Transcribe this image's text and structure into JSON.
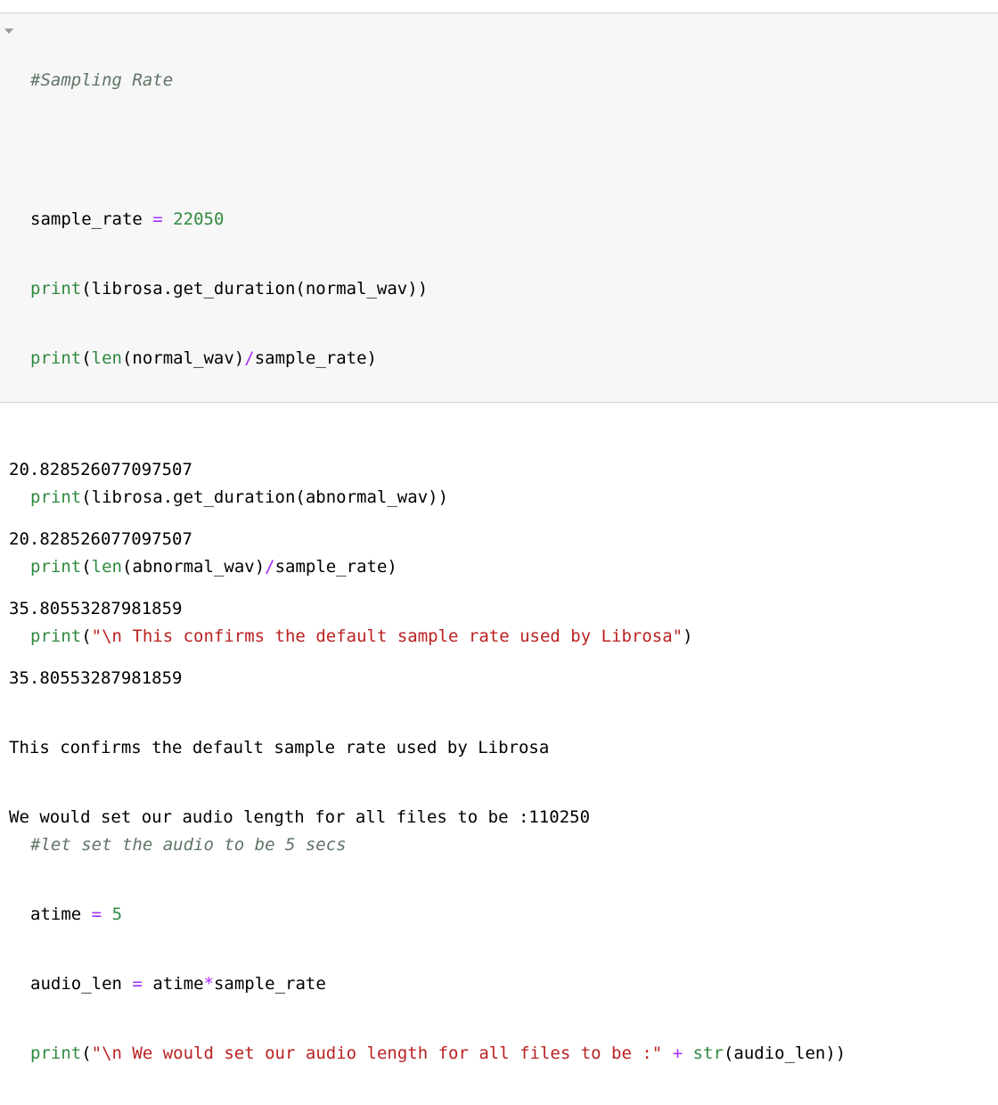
{
  "code": {
    "comment_title": "#Sampling Rate",
    "line_sample_rate": {
      "var": "sample_rate",
      "op": "=",
      "value": "22050"
    },
    "line_print_duration_normal": {
      "fn": "print",
      "rest": "(librosa.get_duration(normal_wav))"
    },
    "line_print_len_normal": {
      "fn": "print",
      "open": "(",
      "len": "len",
      "arg": "(normal_wav)",
      "op": "/",
      "tail": "sample_rate)"
    },
    "line_print_duration_abnormal": {
      "fn": "print",
      "rest": "(librosa.get_duration(abnormal_wav))"
    },
    "line_print_len_abnormal": {
      "fn": "print",
      "open": "(",
      "len": "len",
      "arg": "(abnormal_wav)",
      "op": "/",
      "tail": "sample_rate)"
    },
    "line_print_confirm": {
      "fn": "print",
      "open": "(",
      "str": "\"\\n This confirms the default sample rate used by Librosa\"",
      "close": ")"
    },
    "comment_audio": "#let set the audio to be 5 secs",
    "line_atime": {
      "var": "atime",
      "op": "=",
      "value": "5"
    },
    "line_audio_len": {
      "var": "audio_len",
      "op": "=",
      "a": "atime",
      "mul": "*",
      "b": "sample_rate"
    },
    "line_print_length": {
      "fn": "print",
      "open": "(",
      "str": "\"\\n We would set our audio length for all files to be :\"",
      "plus": "+",
      "strfn": "str",
      "tail": "(audio_len))"
    }
  },
  "output": [
    "20.828526077097507",
    "20.828526077097507",
    "35.80553287981859",
    "35.80553287981859",
    "This confirms the default sample rate used by Librosa",
    "We would set our audio length for all files to be :110250"
  ]
}
